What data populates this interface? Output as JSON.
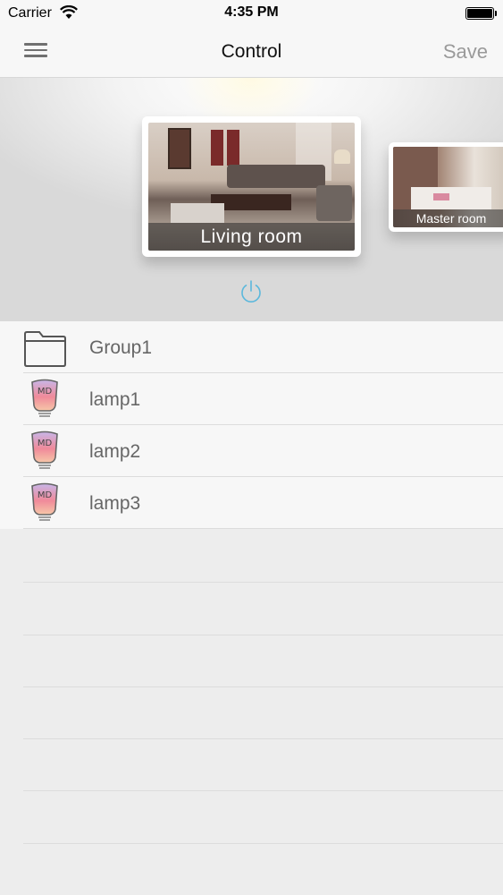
{
  "status": {
    "carrier": "Carrier",
    "time": "4:35 PM"
  },
  "nav": {
    "title": "Control",
    "save_label": "Save"
  },
  "rooms": [
    {
      "name": "Living room",
      "selected": true
    },
    {
      "name": "Master room",
      "selected": false
    }
  ],
  "list": [
    {
      "label": "Group1",
      "icon": "folder-icon"
    },
    {
      "label": "lamp1",
      "icon": "lamp-icon",
      "badge": "MD"
    },
    {
      "label": "lamp2",
      "icon": "lamp-icon",
      "badge": "MD"
    },
    {
      "label": "lamp3",
      "icon": "lamp-icon",
      "badge": "MD"
    }
  ],
  "colors": {
    "accent": "#5bb8dc",
    "nav_bg": "#f7f7f7",
    "list_text": "#666666"
  }
}
